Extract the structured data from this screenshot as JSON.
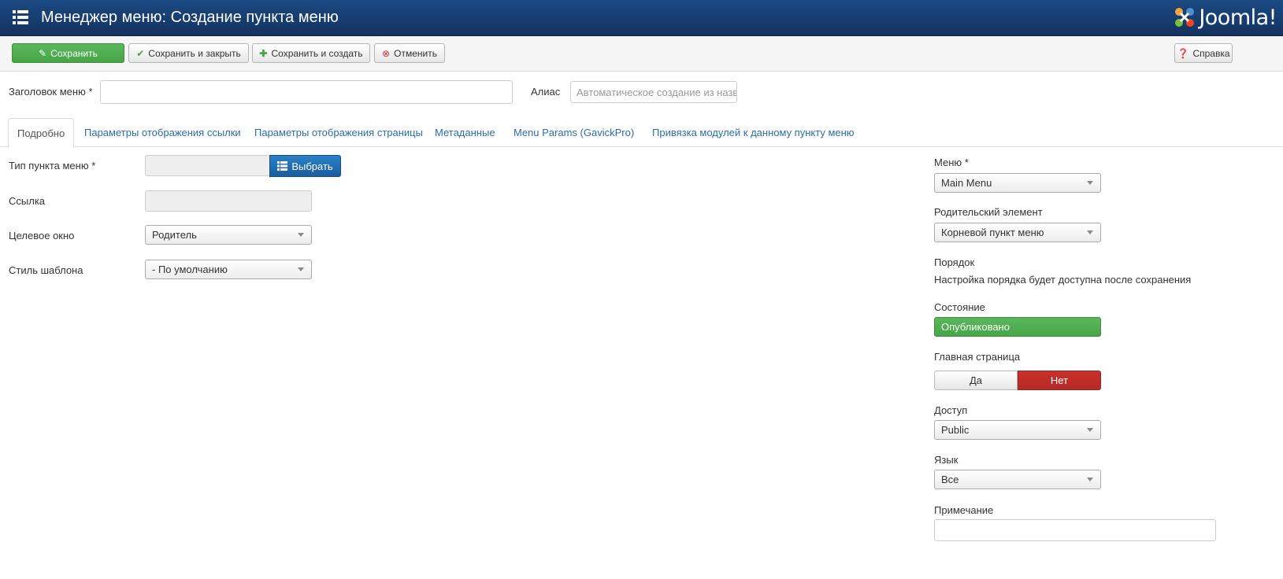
{
  "header": {
    "title": "Менеджер меню: Создание пункта меню",
    "logo_text": "Joomla!"
  },
  "toolbar": {
    "save": "Сохранить",
    "save_close": "Сохранить и закрыть",
    "save_new": "Сохранить и создать",
    "cancel": "Отменить",
    "help": "Справка"
  },
  "title_row": {
    "menu_title_label": "Заголовок меню *",
    "menu_title_value": "",
    "alias_label": "Алиас",
    "alias_placeholder": "Автоматическое создание из назв"
  },
  "tabs": [
    {
      "label": "Подробно",
      "active": true
    },
    {
      "label": "Параметры отображения ссылки"
    },
    {
      "label": "Параметры отображения страницы"
    },
    {
      "label": "Метаданные"
    },
    {
      "label": "Menu Params (GavickPro)"
    },
    {
      "label": "Привязка модулей к данному пункту меню"
    }
  ],
  "left_form": {
    "item_type_label": "Тип пункта меню *",
    "choose_button": "Выбрать",
    "link_label": "Ссылка",
    "target_label": "Целевое окно",
    "target_value": "Родитель",
    "template_style_label": "Стиль шаблона",
    "template_style_value": "- По умолчанию"
  },
  "right_form": {
    "menu_label": "Меню *",
    "menu_value": "Main Menu",
    "parent_label": "Родительский элемент",
    "parent_value": "Корневой пункт меню",
    "ordering_label": "Порядок",
    "ordering_text": "Настройка порядка будет доступна после сохранения",
    "status_label": "Состояние",
    "status_value": "Опубликовано",
    "home_label": "Главная страница",
    "home_yes": "Да",
    "home_no": "Нет",
    "access_label": "Доступ",
    "access_value": "Public",
    "language_label": "Язык",
    "language_value": "Все",
    "note_label": "Примечание",
    "note_value": ""
  },
  "colors": {
    "header_bg": "#1b4a83",
    "save_green": "#46a546",
    "choose_blue": "#1a5e9e",
    "no_red": "#c9302c",
    "tab_link": "#2a6da8"
  }
}
